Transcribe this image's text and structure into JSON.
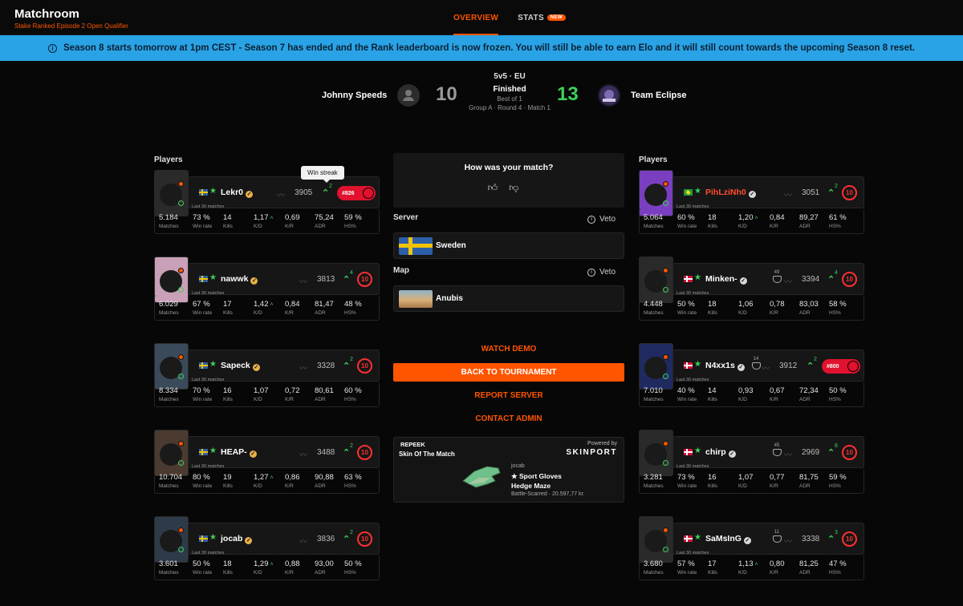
{
  "header": {
    "title": "Matchroom",
    "subtitle": "Stake Ranked Episode 2 Open Qualifier",
    "tabs": [
      {
        "label": "OVERVIEW",
        "active": true
      },
      {
        "label": "STATS",
        "badge": "NEW"
      }
    ]
  },
  "banner": {
    "text": "Season 8 starts tomorrow at 1pm CEST - Season 7 has ended and the Rank leaderboard is now frozen. You will still be able to earn Elo and it will still count towards the upcoming Season 8 reset.",
    "color": "#29a3e6"
  },
  "match": {
    "team1": {
      "name": "Johnny Speeds",
      "score": "10"
    },
    "team2": {
      "name": "Team Eclipse",
      "score": "13"
    },
    "mode": "5v5 · EU",
    "status": "Finished",
    "format": "Best of 1",
    "round": "Group A · Round 4 · Match 1"
  },
  "labels": {
    "players": "Players",
    "last30": "Last 30 matches",
    "stat_labels": [
      "Matches",
      "Win rate",
      "Kills",
      "K/D",
      "K/R",
      "ADR",
      "HS%"
    ],
    "tooltip": "Win streak"
  },
  "center": {
    "rating_question": "How was your match?",
    "server_label": "Server",
    "server_value": "Sweden",
    "map_label": "Map",
    "map_value": "Anubis",
    "veto_label": "Veto",
    "watch_demo": "WATCH DEMO",
    "back": "BACK TO TOURNAMENT",
    "report": "REPORT SERVER",
    "contact": "CONTACT ADMIN",
    "skin": {
      "brand": "REPEEK",
      "title": "Skin Of The Match",
      "powered": "Powered by",
      "sponsor": "SKINPORT",
      "owner": "jocab",
      "name1": "★ Sport Gloves",
      "name2": "Hedge Maze",
      "detail": "Battle-Scarred · 20.597,77 kr."
    }
  },
  "team1_players": [
    {
      "name": "Lekr0",
      "flag": "se",
      "elo": "3905",
      "streak": "2",
      "rank": "#826",
      "stats": [
        "5.184",
        "73 %",
        "14",
        "1,17",
        "0,69",
        "75,24",
        "59 %"
      ],
      "kd_up": true
    },
    {
      "name": "nawwk",
      "flag": "se",
      "elo": "3813",
      "streak": "4",
      "level": "10",
      "stats": [
        "6.029",
        "67 %",
        "17",
        "1,42",
        "0,84",
        "81,47",
        "48 %"
      ],
      "kd_up": true
    },
    {
      "name": "Sapeck",
      "flag": "se",
      "elo": "3328",
      "streak": "2",
      "level": "10",
      "stats": [
        "8.334",
        "70 %",
        "16",
        "1,07",
        "0,72",
        "80,61",
        "60 %"
      ],
      "kd_up": false
    },
    {
      "name": "HEAP-",
      "flag": "se",
      "elo": "3488",
      "streak": "2",
      "level": "10",
      "stats": [
        "10.704",
        "80 %",
        "19",
        "1,27",
        "0,86",
        "90,88",
        "63 %"
      ],
      "kd_up": true
    },
    {
      "name": "jocab",
      "flag": "se",
      "elo": "3836",
      "streak": "2",
      "level": "10",
      "stats": [
        "3.601",
        "50 %",
        "18",
        "1,29",
        "0,88",
        "93,00",
        "50 %"
      ],
      "kd_up": true
    }
  ],
  "team2_players": [
    {
      "name": "PihLziNh0",
      "flag": "br",
      "elo": "3051",
      "streak": "2",
      "level": "10",
      "stats": [
        "5.064",
        "60 %",
        "18",
        "1,20",
        "0,84",
        "89,27",
        "61 %"
      ],
      "kd_up": true
    },
    {
      "name": "Minken-",
      "flag": "dk",
      "elo": "3394",
      "streak": "4",
      "level": "10",
      "fbadge": "49",
      "stats": [
        "4.448",
        "50 %",
        "18",
        "1,06",
        "0,78",
        "83,03",
        "58 %"
      ],
      "kd_up": false
    },
    {
      "name": "N4xx1s",
      "flag": "dk",
      "elo": "3912",
      "streak": "2",
      "rank": "#800",
      "fbadge": "14",
      "stats": [
        "7.010",
        "40 %",
        "14",
        "0,93",
        "0,67",
        "72,34",
        "50 %"
      ],
      "kd_up": false
    },
    {
      "name": "chirp",
      "flag": "dk",
      "elo": "2969",
      "streak": "8",
      "level": "10",
      "fbadge": "45",
      "stats": [
        "3.281",
        "73 %",
        "16",
        "1,07",
        "0,77",
        "81,75",
        "59 %"
      ],
      "kd_up": false
    },
    {
      "name": "SaMsInG",
      "flag": "dk",
      "elo": "3338",
      "streak": "3",
      "level": "10",
      "fbadge": "11",
      "stats": [
        "3.680",
        "57 %",
        "17",
        "1,13",
        "0,80",
        "81,25",
        "47 %"
      ],
      "kd_up": true
    }
  ]
}
